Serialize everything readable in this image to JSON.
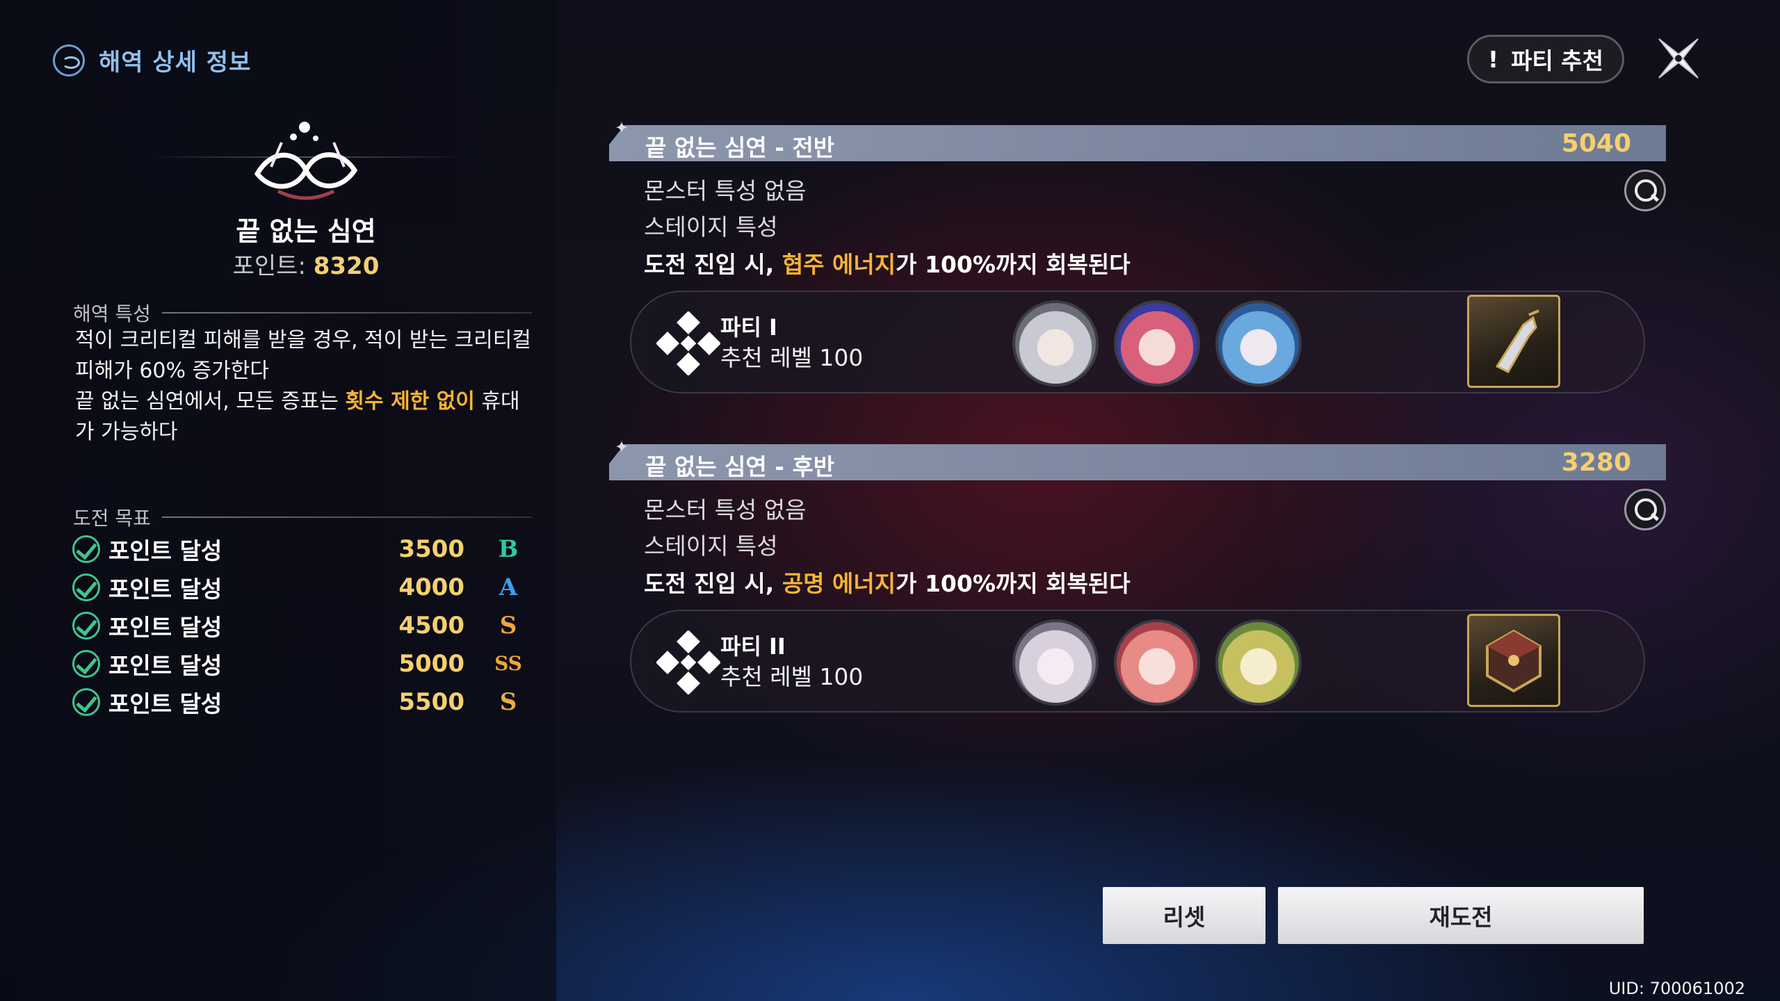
{
  "header": {
    "title": "해역 상세 정보",
    "icon": "sea-area-icon"
  },
  "top_buttons": {
    "party_recommend_mark": "!",
    "party_recommend_label": "파티 추천",
    "close_icon": "close-x-icon"
  },
  "sea_area": {
    "name": "끝 없는 심연",
    "points_label": "포인트:",
    "points_value": "8320"
  },
  "features": {
    "label": "해역 특성",
    "line1": "적이 크리티컬 피해를 받을 경우, 적이 받는 크리티컬 피해가 60% 증가한다",
    "line2_a": "끝 없는 심연에서, 모든 증표는 ",
    "line2_hl": "횟수 제한 없이",
    "line2_b": " 휴대가 가능하다"
  },
  "goals": {
    "label": "도전 목표",
    "items": [
      {
        "label": "포인트 달성",
        "value": "3500",
        "grade": "B",
        "grade_color": "#2ec7a0"
      },
      {
        "label": "포인트 달성",
        "value": "4000",
        "grade": "A",
        "grade_color": "#3a9ee8"
      },
      {
        "label": "포인트 달성",
        "value": "4500",
        "grade": "S",
        "grade_color": "#f0a63a"
      },
      {
        "label": "포인트 달성",
        "value": "5000",
        "grade": "SS",
        "grade_color": "#f0a63a"
      },
      {
        "label": "포인트 달성",
        "value": "5500",
        "grade": "S",
        "grade_color": "#e8b040"
      }
    ]
  },
  "stages": [
    {
      "title": "끝 없는 심연 - 전반",
      "score": "5040",
      "monster": "몬스터 특성  없음",
      "stage_feature": "스테이지 특성",
      "desc_a": "도전 진입 시, ",
      "desc_hl": "협주 에너지",
      "desc_b": "가 100%까지 회복된다",
      "party_name": "파티 I",
      "party_level": "추천 레벨 100",
      "portrait_colors": [
        "#c9c9d4",
        "#d8607a",
        "#6aa8e0"
      ],
      "item_icon": "lantern-item-icon"
    },
    {
      "title": "끝 없는 심연 - 후반",
      "score": "3280",
      "monster": "몬스터 특성  없음",
      "stage_feature": "스테이지 특성",
      "desc_a": "도전 진입 시, ",
      "desc_hl": "공명 에너지",
      "desc_b": "가 100%까지 회복된다",
      "party_name": "파티 II",
      "party_level": "추천 레벨 100",
      "portrait_colors": [
        "#d8d0dc",
        "#e88a86",
        "#c6c060"
      ],
      "item_icon": "dice-item-icon"
    }
  ],
  "footer": {
    "reset_label": "리셋",
    "retry_label": "재도전",
    "uid": "UID: 700061002"
  },
  "colors": {
    "accent_gold": "#f5d070",
    "highlight_orange": "#f7b334",
    "header_blue": "#8fc0ee"
  }
}
